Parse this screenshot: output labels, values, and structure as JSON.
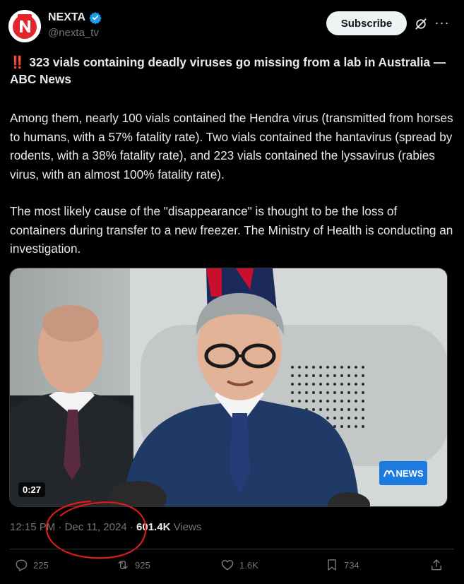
{
  "account": {
    "display_name": "NEXTA",
    "handle": "@nexta_tv",
    "avatar_icon": "nexta-logo-icon",
    "verified_icon": "verified-badge-icon",
    "brand_red": "#e4252d",
    "verified_blue": "#1d9bf0"
  },
  "header": {
    "subscribe_label": "Subscribe",
    "grok_icon": "grok-icon",
    "more_icon": "more-icon"
  },
  "tweet": {
    "headline_emoji": "‼️",
    "headline": "323 vials containing deadly viruses go missing from a lab in Australia — ABC News",
    "paragraph_1": "Among them, nearly 100 vials contained the Hendra virus (transmitted from horses to humans, with a 57% fatality rate). Two vials contained the hantavirus (spread by rodents, with a 38% fatality rate), and 223 vials contained the lyssavirus (rabies virus, with an almost 100% fatality rate).",
    "paragraph_2": "The most likely cause of the \"disappearance\" is thought to be the loss of containers during transfer to a new freezer. The Ministry of Health is conducting an investigation."
  },
  "media": {
    "duration": "0:27",
    "watermark": "NEWS",
    "watermark_color": "#1c7ae0"
  },
  "meta": {
    "time": "12:15 PM",
    "date": "Dec 11, 2024",
    "views_count": "601.4K",
    "views_label": "Views",
    "annotation_color": "#d81c1c"
  },
  "actions": {
    "replies": "225",
    "reposts": "925",
    "likes": "1.6K",
    "bookmarks": "734"
  }
}
